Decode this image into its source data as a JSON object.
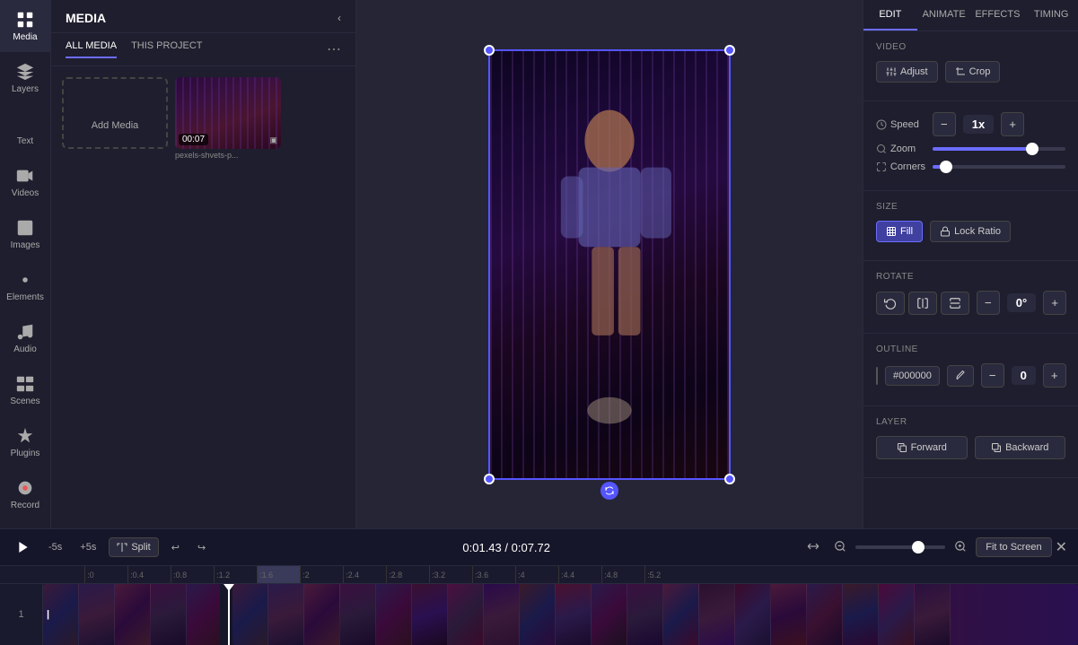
{
  "sidebar": {
    "items": [
      {
        "id": "media",
        "label": "Media",
        "active": true
      },
      {
        "id": "layers",
        "label": "Layers"
      },
      {
        "id": "text",
        "label": "Text"
      },
      {
        "id": "videos",
        "label": "Videos"
      },
      {
        "id": "images",
        "label": "Images"
      },
      {
        "id": "elements",
        "label": "Elements"
      },
      {
        "id": "audio",
        "label": "Audio"
      },
      {
        "id": "scenes",
        "label": "Scenes"
      },
      {
        "id": "plugins",
        "label": "Plugins"
      },
      {
        "id": "record",
        "label": "Record"
      }
    ]
  },
  "media_panel": {
    "title": "MEDIA",
    "tabs": [
      {
        "id": "all",
        "label": "ALL MEDIA",
        "active": true
      },
      {
        "id": "project",
        "label": "THIS PROJECT"
      }
    ],
    "add_media_label": "Add Media",
    "clip": {
      "duration": "00:07",
      "name": "pexels-shvets-p..."
    }
  },
  "timeline": {
    "play_btn": "▶",
    "minus5": "-5s",
    "plus5": "+5s",
    "split_label": "Split",
    "current_time": "0:01.43",
    "total_time": "0:07.72",
    "fit_label": "Fit to Screen",
    "ruler_marks": [
      ":0",
      ":0.4",
      ":0.8",
      ":1.2",
      ":1.6",
      ":2",
      ":2.4",
      ":2.8",
      ":3.2",
      ":3.6",
      ":4",
      ":4.4",
      ":4.8",
      ":5.2"
    ],
    "track_number": "1"
  },
  "right_panel": {
    "tabs": [
      "EDIT",
      "ANIMATE",
      "EFFECTS",
      "TIMING"
    ],
    "active_tab": "EDIT",
    "sections": {
      "video_label": "VIDEO",
      "adjust_label": "Adjust",
      "crop_label": "Crop",
      "speed_label": "Speed",
      "speed_value": "1x",
      "zoom_label": "Zoom",
      "corners_label": "Corners",
      "size_label": "SIZE",
      "fill_label": "Fill",
      "lock_ratio_label": "Lock Ratio",
      "rotate_label": "ROTATE",
      "rotate_value": "0°",
      "outline_label": "OUTLINE",
      "outline_hex": "#000000",
      "outline_value": "0",
      "layer_label": "LAYER",
      "forward_label": "Forward",
      "backward_label": "Backward"
    }
  }
}
